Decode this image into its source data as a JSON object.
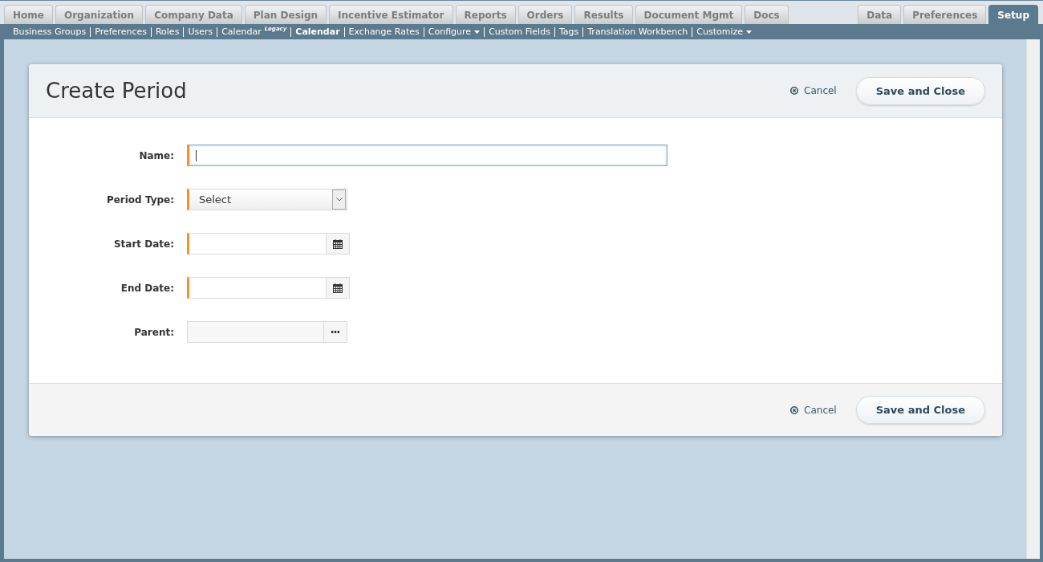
{
  "main_tabs": [
    {
      "label": "Home",
      "selected": false
    },
    {
      "label": "Organization",
      "selected": false
    },
    {
      "label": "Company Data",
      "selected": false
    },
    {
      "label": "Plan Design",
      "selected": false
    },
    {
      "label": "Incentive Estimator",
      "selected": false
    },
    {
      "label": "Reports",
      "selected": false
    },
    {
      "label": "Orders",
      "selected": false
    },
    {
      "label": "Results",
      "selected": false
    },
    {
      "label": "Document Mgmt",
      "selected": false
    },
    {
      "label": "Docs",
      "selected": false
    }
  ],
  "right_tabs": [
    {
      "label": "Data",
      "selected": false
    },
    {
      "label": "Preferences",
      "selected": false
    },
    {
      "label": "Setup",
      "selected": true
    }
  ],
  "sub_nav": [
    {
      "label": "Business Groups",
      "selected": false,
      "has_menu": false
    },
    {
      "label": "Preferences",
      "selected": false,
      "has_menu": false
    },
    {
      "label": "Roles",
      "selected": false,
      "has_menu": false
    },
    {
      "label": "Users",
      "selected": false,
      "has_menu": false
    },
    {
      "label": "Calendar",
      "badge": "Legacy",
      "selected": false,
      "has_menu": false
    },
    {
      "label": "Calendar",
      "selected": true,
      "has_menu": false
    },
    {
      "label": "Exchange Rates",
      "selected": false,
      "has_menu": false
    },
    {
      "label": "Configure",
      "selected": false,
      "has_menu": true
    },
    {
      "label": "Custom Fields",
      "selected": false,
      "has_menu": false
    },
    {
      "label": "Tags",
      "selected": false,
      "has_menu": false
    },
    {
      "label": "Translation Workbench",
      "selected": false,
      "has_menu": false
    },
    {
      "label": "Customize",
      "selected": false,
      "has_menu": true
    }
  ],
  "dialog": {
    "title": "Create Period",
    "header_actions": {
      "cancel": "Cancel",
      "save": "Save and Close"
    },
    "fields": [
      {
        "kind": "text",
        "label": "Name:",
        "required": true,
        "focused": true
      },
      {
        "kind": "select",
        "label": "Period Type:",
        "value": "Select",
        "required": true,
        "focused": false
      },
      {
        "kind": "date",
        "label": "Start Date:",
        "required": true,
        "focused": false
      },
      {
        "kind": "date",
        "label": "End Date:",
        "required": true,
        "focused": false
      },
      {
        "kind": "lookup",
        "label": "Parent:",
        "required": false,
        "focused": false
      }
    ],
    "footer_actions": {
      "cancel": "Cancel",
      "save": "Save and Close"
    }
  }
}
